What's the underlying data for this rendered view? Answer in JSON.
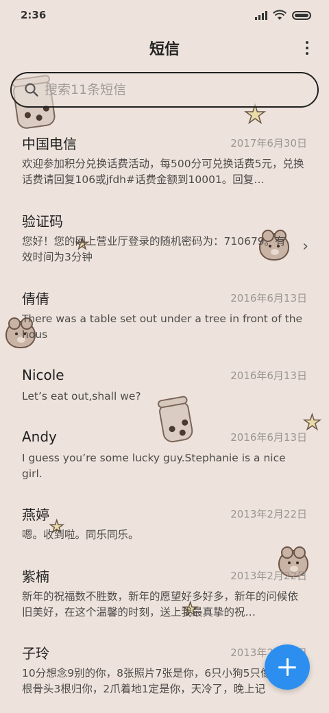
{
  "status_bar": {
    "time": "2:36"
  },
  "header": {
    "title": "短信"
  },
  "search": {
    "placeholder": "搜索11条短信"
  },
  "messages": [
    {
      "sender": "中国电信",
      "date": "2017年6月30日",
      "preview": "欢迎参加积分兑换话费活动，每500分可兑换话费5元，兑换话费请回复106或jfdh#话费金额到10001。回复…"
    },
    {
      "sender": "验证码",
      "date": "",
      "preview": "您好！您的网上营业厅登录的随机密码为：710679。有效时间为3分钟"
    },
    {
      "sender": "倩倩",
      "date": "2016年6月13日",
      "preview": "There was a table set out under a tree in front of the hous"
    },
    {
      "sender": "Nicole",
      "date": "2016年6月13日",
      "preview": "Let’s eat out,shall we?"
    },
    {
      "sender": "Andy",
      "date": "2016年6月13日",
      "preview": "I guess you’re some lucky guy.Stephanie is a nice girl."
    },
    {
      "sender": "燕婷",
      "date": "2013年2月22日",
      "preview": "嗯。收到啦。同乐同乐。"
    },
    {
      "sender": "紫楠",
      "date": "2013年2月22日",
      "preview": "新年的祝福数不胜数，新年的愿望好多好多，新年的问候依旧美好，在这个温馨的时刻，送上我最真挚的祝…"
    },
    {
      "sender": "子玲",
      "date": "2013年2月22日",
      "preview": "10分想念9别的你，8张照片7张是你，6只小狗5只像你，4根骨头3根归你，2爪着地1定是你，天冷了，晚上记"
    }
  ],
  "icons": {
    "search": "search-icon",
    "more": "more-vertical-icon",
    "chevron": "chevron-right-icon",
    "compose": "plus-icon"
  },
  "colors": {
    "background": "#ede3dc",
    "accent": "#2c8ff0"
  }
}
